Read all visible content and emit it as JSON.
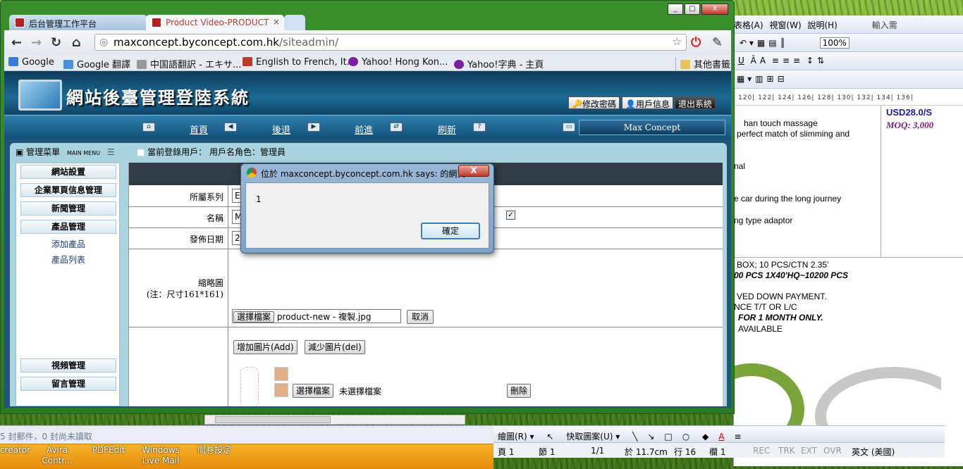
{
  "browser": {
    "tabs": [
      {
        "label": "后台管理工作平台"
      },
      {
        "label": "Product Video-PRODUCT"
      }
    ],
    "tab_close": "×",
    "url_host": "maxconcept.byconcept.com.hk",
    "url_path": "/siteadmin/",
    "window_buttons": {
      "minimize": "_",
      "maximize": "□",
      "close": "X"
    },
    "bookmarks": [
      {
        "label": "Google",
        "color": "#3a7bd5"
      },
      {
        "label": "Google 翻譯",
        "color": "#4a90d9"
      },
      {
        "label": "中国語翻訳 - エキサ...",
        "color": "#999999"
      },
      {
        "label": "English to French, It...",
        "color": "#c0392b"
      },
      {
        "label": "Yahoo! Hong Kon...",
        "color": "#7b1fa2"
      },
      {
        "label": "Yahoo!字典 - 主頁",
        "color": "#7b1fa2"
      }
    ],
    "other_bookmarks": "其他書籤"
  },
  "site": {
    "banner_title": "網站後臺管理登陸系統",
    "top_buttons": {
      "change_password": "修改密碼",
      "user_info": "用戶信息",
      "logout": "退出系統"
    },
    "nav": {
      "home": "首頁",
      "back": "後退",
      "forward": "前進",
      "refresh": "刷新"
    },
    "brand": "Max Concept",
    "menu_title": "管理菜單",
    "menu_sub": "MAIN MENU",
    "current_user": "當前登錄用戶： 用戶名角色：管理員",
    "sidebar": {
      "site_settings": "網站設置",
      "enterprise_pages": "企業單頁信息管理",
      "news": "新聞管理",
      "products": "產品管理",
      "add_product": "添加產品",
      "product_list": "產品列表",
      "videos": "視頻管理",
      "messages": "留言管理"
    },
    "form": {
      "category_label": "所屬系列",
      "category_value": "E",
      "name_label": "名稱",
      "name_value": "MC",
      "date_label": "發佈日期",
      "date_value": "20",
      "thumb_label": "縮略圖",
      "thumb_note": "(注：尺寸161*161)",
      "choose_file": "選擇檔案",
      "file_name": "product-new - 複製.jpg",
      "cancel": "取消",
      "add_image": "增加圖片(Add)",
      "remove_image": "減少圖片(del)",
      "no_file": "未選擇檔案",
      "delete": "刪除"
    }
  },
  "dialog": {
    "title": "位於 maxconcept.byconcept.com.hk says: 的網頁",
    "message": "1",
    "ok": "確定",
    "close": "X"
  },
  "word": {
    "menu": [
      "表格(A)",
      "視窗(W)",
      "說明(H)"
    ],
    "zoom": "100%",
    "ruler": "120| 122| 124| 126| 128| 130| 132| 134| 136|",
    "price": "USD28.0/S",
    "moq": "MOQ: 3,000",
    "lines": [
      "han touch massage",
      "perfect match of slimming and",
      "nal",
      "e car during the long journey",
      "ng type adaptor",
      "BOX; 10 PCS/CTN 2.35'",
      "00 PCS        1X40'HQ~10200 PCS",
      "VED DOWN PAYMENT.",
      "NCE T/T OR L/C",
      "FOR 1 MONTH ONLY.",
      "AVAILABLE"
    ],
    "draw_toolbar": [
      "繪圖(R) ▾",
      "快取圖案(U) ▾"
    ],
    "status": {
      "page": "頁 1",
      "section": "節 1",
      "pages": "1/1",
      "at": "於 11.7cm",
      "line": "行 16",
      "col": "欄 1",
      "rec": "REC",
      "trk": "TRK",
      "ext": "EXT",
      "ovr": "OVR",
      "lang": "英文 (美國)"
    },
    "input_hint": "輸入需"
  },
  "outlook_status": "5 封郵件，0 封尚未讀取",
  "taskbar": [
    "creator",
    "Avira Contr...",
    "PDFEdit",
    "Windows Live Mail",
    "問卷設定"
  ]
}
